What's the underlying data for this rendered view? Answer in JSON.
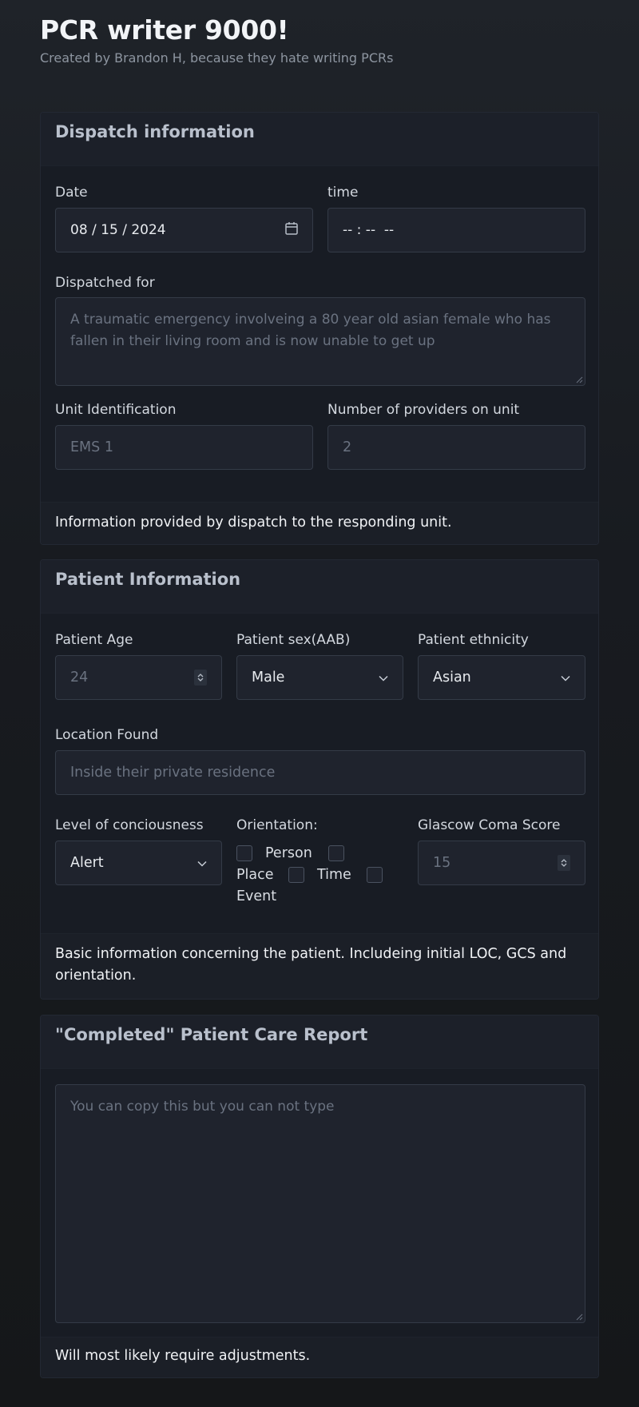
{
  "header": {
    "title": "PCR writer 9000!",
    "subtitle": "Created by Brandon H, because they hate writing PCRs"
  },
  "dispatch": {
    "title": "Dispatch information",
    "date_label": "Date",
    "date_value": "08 / 15 / 2024",
    "time_label": "time",
    "time_value": "-- : --  --",
    "dispatched_for_label": "Dispatched for",
    "dispatched_for_placeholder": "A traumatic emergency involveing a 80 year old asian female who has fallen in their living room and is now unable to get up",
    "unit_label": "Unit Identification",
    "unit_placeholder": "EMS 1",
    "providers_label": "Number of providers on unit",
    "providers_placeholder": "2",
    "footer": "Information provided by dispatch to the responding unit."
  },
  "patient": {
    "title": "Patient Information",
    "age_label": "Patient Age",
    "age_placeholder": "24",
    "sex_label": "Patient sex(AAB)",
    "sex_value": "Male",
    "ethnicity_label": "Patient ethnicity",
    "ethnicity_value": "Asian",
    "location_label": "Location Found",
    "location_placeholder": "Inside their private residence",
    "loc_label": "Level of conciousness",
    "loc_value": "Alert",
    "orientation_label": "Orientation:",
    "orientation_options": [
      "Person",
      "Place",
      "Time",
      "Event"
    ],
    "gcs_label": "Glascow Coma Score",
    "gcs_placeholder": "15",
    "footer": "Basic information concerning the patient. Includeing initial LOC, GCS and orientation."
  },
  "report": {
    "title": "\"Completed\" Patient Care Report",
    "placeholder": "You can copy this but you can not type",
    "footer": "Will most likely require adjustments."
  }
}
